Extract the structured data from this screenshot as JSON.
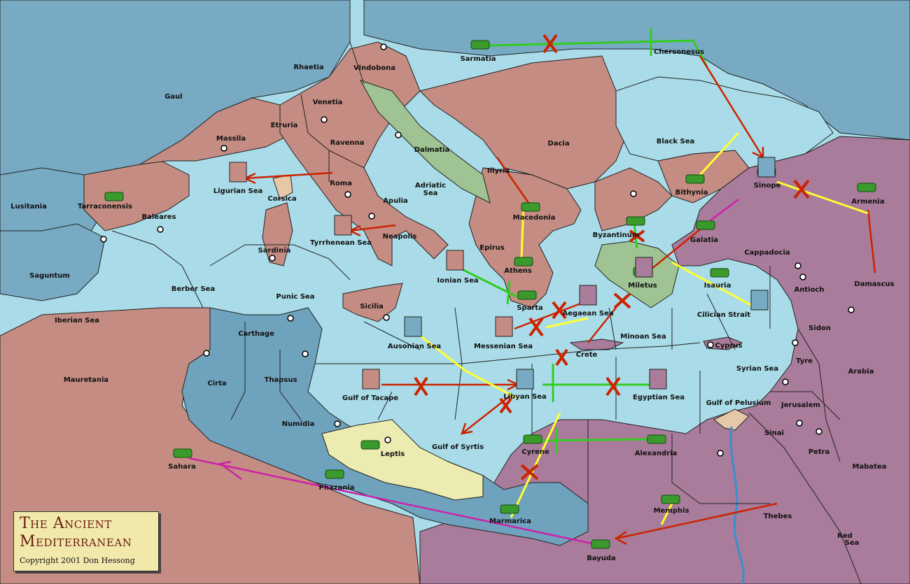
{
  "colors": {
    "sea": "#a9dce8",
    "gaul_sea": "#78aac4",
    "roman": "#c48c82",
    "dalmatia": "#9fc393",
    "persia": "#a87c9a",
    "leptis": "#ecebb0",
    "africa": "#6fa2bd",
    "border": "#222222",
    "green_arrow": "#33cc22",
    "red_arrow": "#cc2200",
    "yellow_arrow": "#ffff33",
    "magenta_arrow": "#cc22aa",
    "title_text": "#6b1a10"
  },
  "title": {
    "line1": "The Ancient",
    "line2": "Mediterranean",
    "copyright": "Copyright  2001  Don Hessong"
  },
  "territories": [
    {
      "id": "gaul",
      "name": "Gaul"
    },
    {
      "id": "rhaetia",
      "name": "Rhaetia"
    },
    {
      "id": "vindobona",
      "name": "Vindobona"
    },
    {
      "id": "sarmatia",
      "name": "Sarmatia"
    },
    {
      "id": "chersonesus",
      "name": "Chersonesus"
    },
    {
      "id": "venetia",
      "name": "Venetia"
    },
    {
      "id": "etruria",
      "name": "Etruria"
    },
    {
      "id": "massila",
      "name": "Massila"
    },
    {
      "id": "ravenna",
      "name": "Ravenna"
    },
    {
      "id": "dalmatia",
      "name": "Dalmatia"
    },
    {
      "id": "dacia",
      "name": "Dacia"
    },
    {
      "id": "black-sea",
      "name": "Black Sea"
    },
    {
      "id": "illyria",
      "name": "Illyria"
    },
    {
      "id": "ligurian-sea",
      "name": "Ligurian Sea"
    },
    {
      "id": "roma",
      "name": "Roma"
    },
    {
      "id": "adriatic-sea",
      "name": "Adriatic Sea"
    },
    {
      "id": "corsica",
      "name": "Corsica"
    },
    {
      "id": "apulia",
      "name": "Apulia"
    },
    {
      "id": "lusitania",
      "name": "Lusitania"
    },
    {
      "id": "tarraconensis",
      "name": "Tarraconensis"
    },
    {
      "id": "baleares",
      "name": "Baleares"
    },
    {
      "id": "tyrrhenean-sea",
      "name": "Tyrrhenean Sea"
    },
    {
      "id": "neapolis",
      "name": "Neapolis"
    },
    {
      "id": "sardinia",
      "name": "Sardinia"
    },
    {
      "id": "macedonia",
      "name": "Macedonia"
    },
    {
      "id": "byzantinum",
      "name": "Byzantinum"
    },
    {
      "id": "bithynia",
      "name": "Bithynia"
    },
    {
      "id": "sinope",
      "name": "Sinope"
    },
    {
      "id": "armenia",
      "name": "Armenia"
    },
    {
      "id": "galatia",
      "name": "Galatia"
    },
    {
      "id": "cappadocia",
      "name": "Cappadocia"
    },
    {
      "id": "epirus",
      "name": "Epirus"
    },
    {
      "id": "athens",
      "name": "Athens"
    },
    {
      "id": "miletus",
      "name": "Miletus"
    },
    {
      "id": "isauria",
      "name": "Isauria"
    },
    {
      "id": "antioch",
      "name": "Antioch"
    },
    {
      "id": "damascus",
      "name": "Damascus"
    },
    {
      "id": "saguntum",
      "name": "Saguntum"
    },
    {
      "id": "berber-sea",
      "name": "Berber Sea"
    },
    {
      "id": "punic-sea",
      "name": "Punic Sea"
    },
    {
      "id": "ionian-sea",
      "name": "Ionian Sea"
    },
    {
      "id": "sicilia",
      "name": "Sicilia"
    },
    {
      "id": "sparta",
      "name": "Sparta"
    },
    {
      "id": "aegaean-sea",
      "name": "Aegaean Sea"
    },
    {
      "id": "cilician-strait",
      "name": "Cilician Strait"
    },
    {
      "id": "iberian-sea",
      "name": "Iberian Sea"
    },
    {
      "id": "sidon",
      "name": "Sidon"
    },
    {
      "id": "carthage",
      "name": "Carthage"
    },
    {
      "id": "ausonian-sea",
      "name": "Ausonian Sea"
    },
    {
      "id": "messenian-sea",
      "name": "Messenian Sea"
    },
    {
      "id": "minoan-sea",
      "name": "Minoan Sea"
    },
    {
      "id": "cyprus",
      "name": "Cyprus"
    },
    {
      "id": "tyre",
      "name": "Tyre"
    },
    {
      "id": "crete",
      "name": "Crete"
    },
    {
      "id": "mauretania",
      "name": "Mauretania"
    },
    {
      "id": "cirta",
      "name": "Cirta"
    },
    {
      "id": "thapsus",
      "name": "Thapsus"
    },
    {
      "id": "syrian-sea",
      "name": "Syrian Sea"
    },
    {
      "id": "arabia",
      "name": "Arabia"
    },
    {
      "id": "gulf-of-tacape",
      "name": "Gulf of Tacape"
    },
    {
      "id": "libyan-sea",
      "name": "Libyan Sea"
    },
    {
      "id": "egyptian-sea",
      "name": "Egyptian Sea"
    },
    {
      "id": "gulf-of-pelusium",
      "name": "Gulf of Pelusium"
    },
    {
      "id": "jerusalem",
      "name": "Jerusalem"
    },
    {
      "id": "numidia",
      "name": "Numidia"
    },
    {
      "id": "sinai",
      "name": "Sinai"
    },
    {
      "id": "leptis",
      "name": "Leptis"
    },
    {
      "id": "gulf-of-syrtis",
      "name": "Gulf of Syrtis"
    },
    {
      "id": "petra",
      "name": "Petra"
    },
    {
      "id": "cyrene",
      "name": "Cyrene"
    },
    {
      "id": "alexandria",
      "name": "Alexandria"
    },
    {
      "id": "mabatea",
      "name": "Mabatea"
    },
    {
      "id": "sahara",
      "name": "Sahara"
    },
    {
      "id": "phazania",
      "name": "Phazania"
    },
    {
      "id": "memphis",
      "name": "Memphis"
    },
    {
      "id": "thebes",
      "name": "Thebes"
    },
    {
      "id": "marmarica",
      "name": "Marmarica"
    },
    {
      "id": "red-sea",
      "name": "Red Sea"
    },
    {
      "id": "bayuda",
      "name": "Bayuda"
    }
  ]
}
